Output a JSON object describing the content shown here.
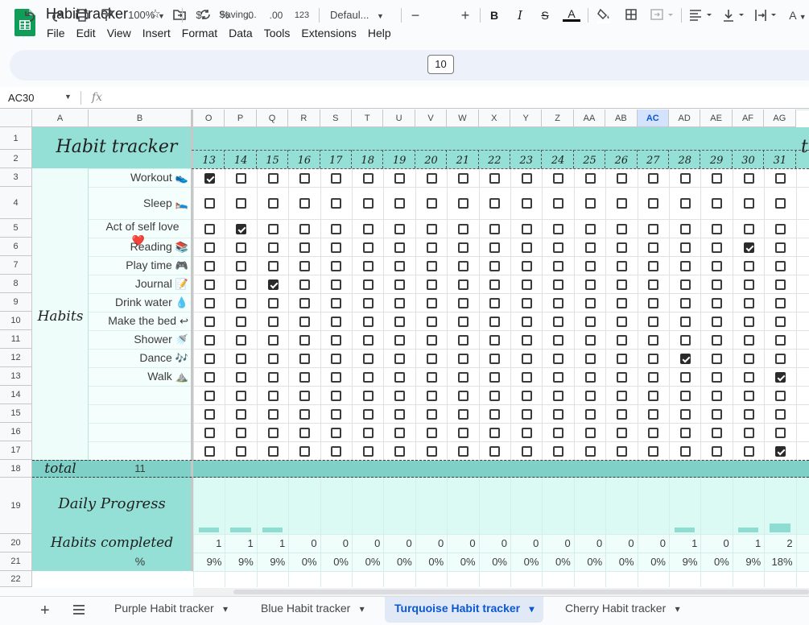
{
  "app": {
    "title": "Habit tracker",
    "status": "Saving...",
    "menu": [
      "File",
      "Edit",
      "View",
      "Insert",
      "Format",
      "Data",
      "Tools",
      "Extensions",
      "Help"
    ]
  },
  "toolbar": {
    "zoom": "100%",
    "currency": "$",
    "percent": "%",
    "decrease_decimal": ".0",
    "increase_decimal": ".00",
    "number_format": "123",
    "font": "Defaul...",
    "font_size": "10",
    "bold": "B",
    "italic": "I",
    "strike": "S",
    "text_color": "A",
    "text_rotate": "A"
  },
  "formula_bar": {
    "cell_ref": "AC30",
    "fx": "fx",
    "value": ""
  },
  "grid": {
    "columns": [
      "A",
      "B",
      "O",
      "P",
      "Q",
      "R",
      "S",
      "T",
      "U",
      "V",
      "W",
      "X",
      "Y",
      "Z",
      "AA",
      "AB",
      "AC",
      "AD",
      "AE",
      "AF",
      "AG"
    ],
    "selected_column": "AC",
    "rows": [
      "1",
      "2",
      "3",
      "4",
      "5",
      "6",
      "7",
      "8",
      "9",
      "10",
      "11",
      "12",
      "13",
      "14",
      "15",
      "16",
      "17",
      "18",
      "19",
      "20",
      "21",
      "22"
    ],
    "heading": "Habit tracker",
    "next_heading_fragment": "t",
    "days": [
      "13",
      "14",
      "15",
      "16",
      "17",
      "18",
      "19",
      "20",
      "21",
      "22",
      "23",
      "24",
      "25",
      "26",
      "27",
      "28",
      "29",
      "30",
      "31"
    ],
    "section_label": "Habits",
    "habits": [
      {
        "label": "Workout",
        "icon": "shoe-icon",
        "glyph": "👟",
        "checked_days": [
          "13"
        ]
      },
      {
        "label": "Sleep",
        "icon": "bed-icon",
        "glyph": "🛌",
        "checked_days": []
      },
      {
        "label": "Act of self love",
        "icon": "heart-icon",
        "glyph": "❤️",
        "checked_days": [
          "14"
        ]
      },
      {
        "label": "Reading",
        "icon": "books-icon",
        "glyph": "📚",
        "checked_days": [
          "30"
        ]
      },
      {
        "label": "Play time",
        "icon": "gamepad-icon",
        "glyph": "🎮",
        "checked_days": []
      },
      {
        "label": "Journal",
        "icon": "memo-icon",
        "glyph": "📝",
        "checked_days": [
          "15"
        ]
      },
      {
        "label": "Drink water",
        "icon": "droplet-icon",
        "glyph": "💧",
        "checked_days": []
      },
      {
        "label": "Make the bed",
        "icon": "bed-arrow-icon",
        "glyph": "↩",
        "checked_days": []
      },
      {
        "label": "Shower",
        "icon": "shower-icon",
        "glyph": "🚿",
        "checked_days": []
      },
      {
        "label": "Dance",
        "icon": "music-icon",
        "glyph": "🎶",
        "checked_days": [
          "28"
        ]
      },
      {
        "label": "Walk",
        "icon": "mountain-icon",
        "glyph": "⛰️",
        "checked_days": [
          "31"
        ]
      },
      {
        "label": "",
        "icon": "",
        "glyph": "",
        "checked_days": []
      },
      {
        "label": "",
        "icon": "",
        "glyph": "",
        "checked_days": []
      },
      {
        "label": "",
        "icon": "",
        "glyph": "",
        "checked_days": []
      },
      {
        "label": "",
        "icon": "",
        "glyph": "",
        "checked_days": [
          "31"
        ]
      }
    ],
    "total_label": "total",
    "total_value": "11",
    "daily_progress_label": "Daily Progress",
    "habits_completed_label": "Habits completed",
    "percent_label": "%",
    "completed_counts": [
      "1",
      "1",
      "1",
      "0",
      "0",
      "0",
      "0",
      "0",
      "0",
      "0",
      "0",
      "0",
      "0",
      "0",
      "0",
      "1",
      "0",
      "1",
      "2"
    ],
    "completed_percents": [
      "9%",
      "9%",
      "9%",
      "0%",
      "0%",
      "0%",
      "0%",
      "0%",
      "0%",
      "0%",
      "0%",
      "0%",
      "0%",
      "0%",
      "0%",
      "9%",
      "0%",
      "9%",
      "18%"
    ],
    "progress_fractions": [
      0.09,
      0.09,
      0.09,
      0,
      0,
      0,
      0,
      0,
      0,
      0,
      0,
      0,
      0,
      0,
      0,
      0.09,
      0,
      0.09,
      0.18
    ]
  },
  "sheet_tabs": [
    {
      "label": "Purple Habit tracker",
      "active": false
    },
    {
      "label": "Blue Habit tracker",
      "active": false
    },
    {
      "label": "Turquoise Habit tracker",
      "active": true
    },
    {
      "label": "Cherry Habit tracker",
      "active": false
    }
  ],
  "colors": {
    "header_teal": "#95e0d6",
    "light_teal": "#dcfaf4",
    "very_light": "#eefdf9",
    "bar_teal": "#8fdcd3",
    "accent_blue": "#0b57d0"
  }
}
